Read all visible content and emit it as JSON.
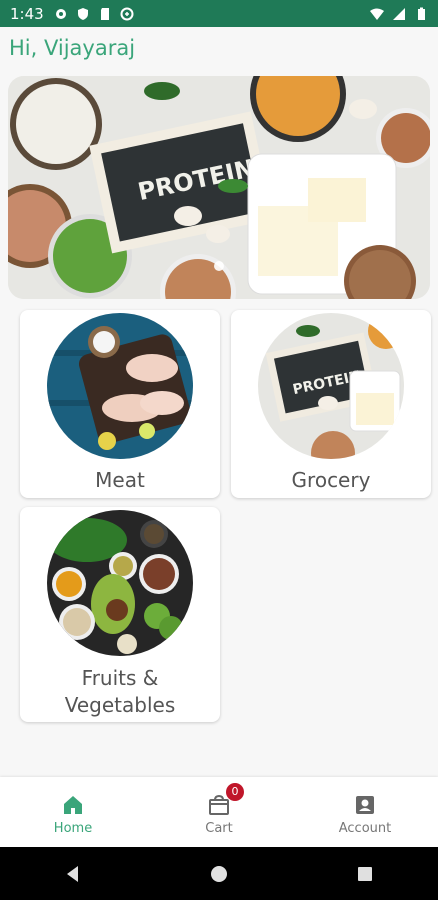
{
  "status_bar": {
    "time": "1:43"
  },
  "greeting": "Hi, Vijayaraj",
  "hero": {
    "banner_text": "PROTEIN"
  },
  "categories": [
    {
      "label": "Meat"
    },
    {
      "label": "Grocery",
      "image_text": "PROTEIN"
    },
    {
      "label_line1": "Fruits &",
      "label_line2": "Vegetables"
    }
  ],
  "bottom_nav": {
    "home": "Home",
    "cart": "Cart",
    "cart_count": "0",
    "account": "Account"
  },
  "colors": {
    "accent": "#3aa57a",
    "status_bar": "#1f7a57",
    "badge": "#c0162a"
  }
}
